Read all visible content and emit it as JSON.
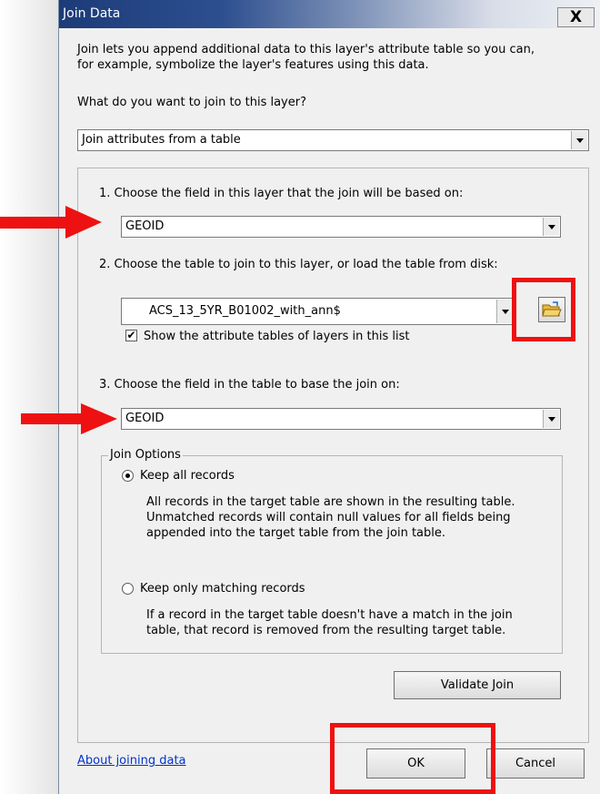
{
  "window": {
    "title": "Join Data",
    "close_label": "X"
  },
  "intro": {
    "line1": "Join lets you append additional data to this layer's attribute table so you can,",
    "line2": "for example, symbolize the layer's features using this data."
  },
  "join_type": {
    "question": "What do you want to join to this layer?",
    "value": "Join attributes from a table"
  },
  "step1": {
    "label": "1.  Choose the field in this layer that the join will be based on:",
    "value": "GEOID"
  },
  "step2": {
    "label": "2.  Choose the table to join to this layer, or load the table from disk:",
    "value": "ACS_13_5YR_B01002_with_ann$",
    "show_layers_label": "Show the attribute tables of layers in this list",
    "show_layers_checked": "✔"
  },
  "step3": {
    "label": "3.  Choose the field in the table to base the join on:",
    "value": "GEOID"
  },
  "join_options": {
    "legend": "Join Options",
    "keep_all": {
      "label": "Keep all records",
      "desc1": "All records in the target table are shown in the resulting table.",
      "desc2": "Unmatched records will contain null values for all fields being",
      "desc3": "appended into the target table from the join table."
    },
    "keep_matching": {
      "label": "Keep only matching records",
      "desc1": "If a record in the target table doesn't have a match in the join",
      "desc2": "table, that record is removed from the resulting target table."
    }
  },
  "buttons": {
    "validate": "Validate Join",
    "ok": "OK",
    "cancel": "Cancel"
  },
  "footer": {
    "about_link": "About joining data"
  },
  "colors": {
    "annotation_red": "#ee1111",
    "title_blue": "#1c3b78"
  }
}
